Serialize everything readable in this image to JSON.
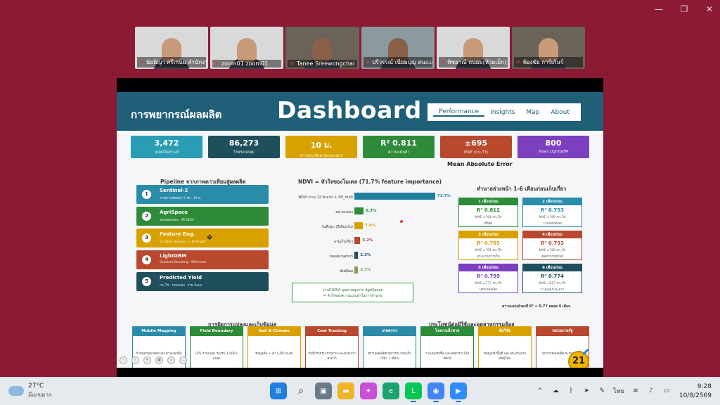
{
  "window_controls": {
    "minimize": "—",
    "restore": "❐",
    "close": "✕"
  },
  "participants": [
    {
      "name": "นัยนิญา ศรีเกนิม สำนักงานเกษตรฯ",
      "bg": "bg1",
      "face": "face"
    },
    {
      "name": "zoom01 zoom01",
      "bg": "bg1",
      "face": "face"
    },
    {
      "name": "Tanee Sreewongchai",
      "bg": "bg2",
      "face": "face dark",
      "active": true
    },
    {
      "name": "ปรีวรรณ์ เนียมบุญ สนง.เกษตร",
      "bg": "bg3",
      "face": "face dark"
    },
    {
      "name": "พิชยาณี ถนอม(ห้วยเม็ก)",
      "bg": "bg1",
      "face": "face"
    },
    {
      "name": "พ้องขัย การ์เก้นร์",
      "bg": "bg2",
      "face": "face"
    }
  ],
  "slide": {
    "header_title": "การพยากรณ์ผลผลิต",
    "header_big": "Dashboard",
    "nav": [
      "Performance",
      "Insights",
      "Map",
      "About"
    ],
    "kpis": [
      {
        "value": "3,472",
        "label": "แปลงวิเคราะห์",
        "color": "#2a9db5"
      },
      {
        "value": "86,273",
        "label": "ไร่ครอบคลุม",
        "color": "#1f4f5c"
      },
      {
        "value": "10 ม.",
        "label": "ความละเอียด Sentinel-2",
        "color": "#d9a100"
      },
      {
        "value": "R² 0.811",
        "label": "ความแม่นยำ",
        "color": "#2e8b3a"
      },
      {
        "value": "±695",
        "label": "MAE (กก./ไร่)",
        "color": "#b8492e"
      },
      {
        "value": "800",
        "label": "Trees LightGBM",
        "color": "#7b3fc0"
      }
    ],
    "mae_caption": "Mean Absolute Error",
    "pipeline_title": "Pipeline  จากภาพดาวเทียมสู่ผลผลิต",
    "pipeline": [
      {
        "n": "1",
        "title": "Sentinel-2",
        "sub": "ภาพดาวเทียมทุก 5 วัน · 10 ม.",
        "color": "#2a8ca8"
      },
      {
        "n": "2",
        "title": "AgriSpace",
        "sub": "ขอบเขตแปลง · ดึง NDVI",
        "color": "#2e8b3a"
      },
      {
        "n": "3",
        "title": "Feature Eng.",
        "sub": "11 NDVI features + 19 ตัวแปร",
        "color": "#d9a100"
      },
      {
        "n": "4",
        "title": "LightGBM",
        "sub": "Gradient Boosting · 800 trees",
        "color": "#b8492e"
      },
      {
        "n": "5",
        "title": "Predicted Yield",
        "sub": "กก./ไร่ · รายแปลง · ราย Zone",
        "color": "#1f4f5c"
      }
    ],
    "ndvi_title": "NDVI  =  หัวใจของโมเดล  (71.7% feature importance)",
    "chart_data": {
      "type": "bar",
      "categories": [
        "NDVI (รวม 12 ตัวแปร + SD_mid)",
        "ขนาดแปลง",
        "วันที่ปลูก (ปีเดือนวัน)",
        "อายุเก็บเกี่ยว",
        "เขตส่งเกษตรกร",
        "พันธุ์อ้อย"
      ],
      "values": [
        71.7,
        8.3,
        7.4,
        5.2,
        3.3,
        3.3
      ],
      "value_labels": [
        "71.7%",
        "8.3%",
        "7.4%",
        "5.2%",
        "3.3%",
        "3.3%"
      ],
      "colors": [
        "#1f7fa0",
        "#2e8b3a",
        "#d9a100",
        "#b8492e",
        "#1f4f5c",
        "#8a9a55"
      ],
      "xlim": [
        0,
        75
      ]
    },
    "ndvi_note": [
      "การมี NDVI คุณภาพสูงจาก AgriSpace",
      "= หัวใจของความแม่นยำในการทำนาย"
    ],
    "forecast_title": "ทำนายล่วงหน้า 1-6 เดือนก่อนเก็บเกี่ยว",
    "forecast": [
      {
        "head": "1 เดือนก่อน",
        "r2": "R²  0.812",
        "mae": "MAE  ±764 กก./ไร่",
        "note": "ดีที่สุด",
        "color": "#2e8b3a"
      },
      {
        "head": "2 เดือนก่อน",
        "r2": "R²  0.793",
        "mae": "MAE  ±769 กก./ไร่",
        "note": "วางแผนขนส่ง",
        "color": "#2a8ca8"
      },
      {
        "head": "3 เดือนก่อน",
        "r2": "R²  0.785",
        "mae": "MAE  ±791 กก./ไร่",
        "note": "ประมาณการเก็บ",
        "color": "#d9a100"
      },
      {
        "head": "4 เดือนก่อน",
        "r2": "R²  0.793",
        "mae": "MAE  ±768 กก./ไร่",
        "note": "ตัดสาขาธุรกิจท์",
        "color": "#b8492e"
      },
      {
        "head": "5 เดือนก่อน",
        "r2": "R²  0.799",
        "mae": "MAE  ±777 กก./ไร่",
        "note": "ปรับแผนผลิต",
        "color": "#7b3fc0"
      },
      {
        "head": "6 เดือนก่อน",
        "r2": "R²  0.774",
        "mae": "MAE  ±817 กก./ไร่",
        "note": "วางแผนระยะยาว",
        "color": "#1f4f5c"
      }
    ],
    "forecast_foot": "ความแม่นยำคงที่ R² ≈ 0.77  ตลอด 6 เดือน",
    "bottom_left_title": "การจัดการแปลงและเก็บข้อมูล",
    "bottom_right_title": "ประโยชน์ต่อผู้ใช้และอุตสาหกรรมอ้อย",
    "bottom_cards": [
      {
        "head": "Mobile Mapping",
        "body": "กำหนดขอบเขตแปลง ผ่านแอปมือถือ",
        "color": "#2a8ca8"
      },
      {
        "head": "Field Boundary",
        "body": "GPS รายแปลง รองรับ 3,000+ แปลง",
        "color": "#2e8b3a"
      },
      {
        "head": "Soil & Climate",
        "body": "ข้อมูลดิน + ค่า GDD สะสม",
        "color": "#d9a100"
      },
      {
        "head": "Cost Tracking",
        "body": "บันทึกรายรับ-รายจ่าย และค่าความคาดไว้",
        "color": "#b8492e"
      },
      {
        "head": "เกษตรกร",
        "body": "ทราบผลผลิตคาดการณ์ ก่อนเก็บเกี่ยว 1 เดือน",
        "color": "#2a8ca8"
      },
      {
        "head": "โรงงานน้ำตาล",
        "body": "วางแผนรับซื้อ และจัดตารางโลจิสติกส์",
        "color": "#2e8b3a"
      },
      {
        "head": "นักวิจัย",
        "body": "ข้อมูลเชิงพื้นที่ และประเมินสายพันธุ์ใหม่",
        "color": "#d9a100"
      },
      {
        "head": "หน่วยงานรัฐ",
        "body": "พยากรณ์ผลผลิต ระดับภูมิภาค",
        "color": "#b8492e"
      }
    ],
    "slide_number": "21"
  },
  "taskbar": {
    "temperature": "27°C",
    "weather_text": "มีเมฆมาก",
    "language": "ไทย",
    "time": "9:28",
    "date": "10/8/2569"
  }
}
